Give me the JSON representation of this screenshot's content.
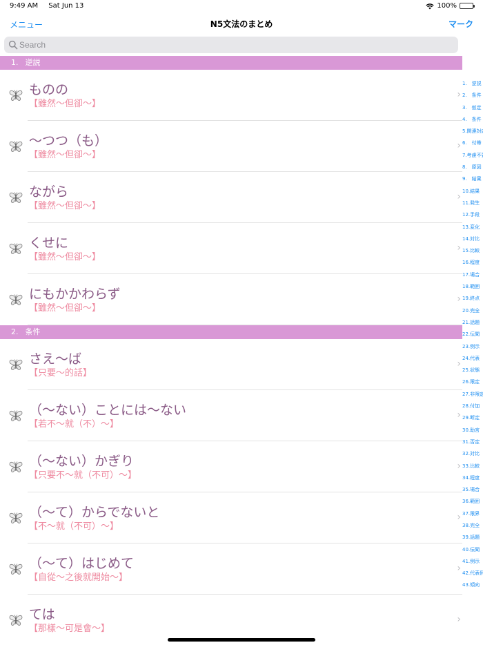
{
  "status_bar": {
    "time": "9:49 AM",
    "date": "Sat Jun 13",
    "battery": "100%",
    "battery_level": 1.0
  },
  "nav": {
    "left_label": "メニュー",
    "title": "N5文法のまとめ",
    "right_label": "マーク"
  },
  "search": {
    "placeholder": "Search"
  },
  "sections": [
    {
      "number": "1.",
      "name": "逆説",
      "rows": [
        {
          "title": "ものの",
          "subtitle": "【雖然〜但卻〜】"
        },
        {
          "title": "〜つつ（も）",
          "subtitle": "【雖然〜但卻〜】"
        },
        {
          "title": "ながら",
          "subtitle": "【雖然〜但卻〜】"
        },
        {
          "title": "くせに",
          "subtitle": "【雖然〜但卻〜】"
        },
        {
          "title": "にもかかわらず",
          "subtitle": "【雖然〜但卻〜】"
        }
      ]
    },
    {
      "number": "2.",
      "name": "条件",
      "rows": [
        {
          "title": "さえ〜ば",
          "subtitle": "【只要〜的話】"
        },
        {
          "title": "（〜ない）ことには〜ない",
          "subtitle": "【若不〜就（不）〜】"
        },
        {
          "title": "（〜ない）かぎり",
          "subtitle": "【只要不〜就（不可）〜】"
        },
        {
          "title": "（〜て）からでないと",
          "subtitle": "【不〜就（不可）〜】"
        },
        {
          "title": "（〜て）はじめて",
          "subtitle": "【自從〜之後就開始〜】"
        },
        {
          "title": "ては",
          "subtitle": "【那樣〜可是會〜】"
        }
      ]
    }
  ],
  "index": [
    "1.　逆説",
    "2.　条件",
    "3.　仮定",
    "4.　条件",
    "5.関連対応",
    "6.　付帯",
    "7.考慮不要",
    "8.　原因",
    "9.　結果",
    "10.結果",
    "11.発生",
    "12.手段",
    "13.変化",
    "14.対比",
    "15.比較",
    "16.程度",
    "17.場合",
    "18.範囲",
    "19.終点",
    "20.完全",
    "21.話題",
    "22.伝聞",
    "23.例示",
    "24.代表",
    "25.状態",
    "26.限定",
    "27.非限定",
    "28.付加",
    "29.断定",
    "30.助言",
    "31.否定",
    "32.対比",
    "33.比較",
    "34.程度",
    "35.場合",
    "36.範囲",
    "37.限界",
    "38.完全",
    "39.話題",
    "40.伝聞",
    "41.例示",
    "42.代表例",
    "43.傾向"
  ],
  "colors": {
    "accent": "#1a8cf0",
    "section_header": "#d998d6",
    "row_title": "#8a5a86",
    "row_subtitle": "#ee8aa0"
  },
  "icons": {
    "row": "butterfly-icon",
    "search": "search-icon",
    "chevron": "chevron-right-icon",
    "wifi": "wifi-icon",
    "battery": "battery-icon"
  }
}
